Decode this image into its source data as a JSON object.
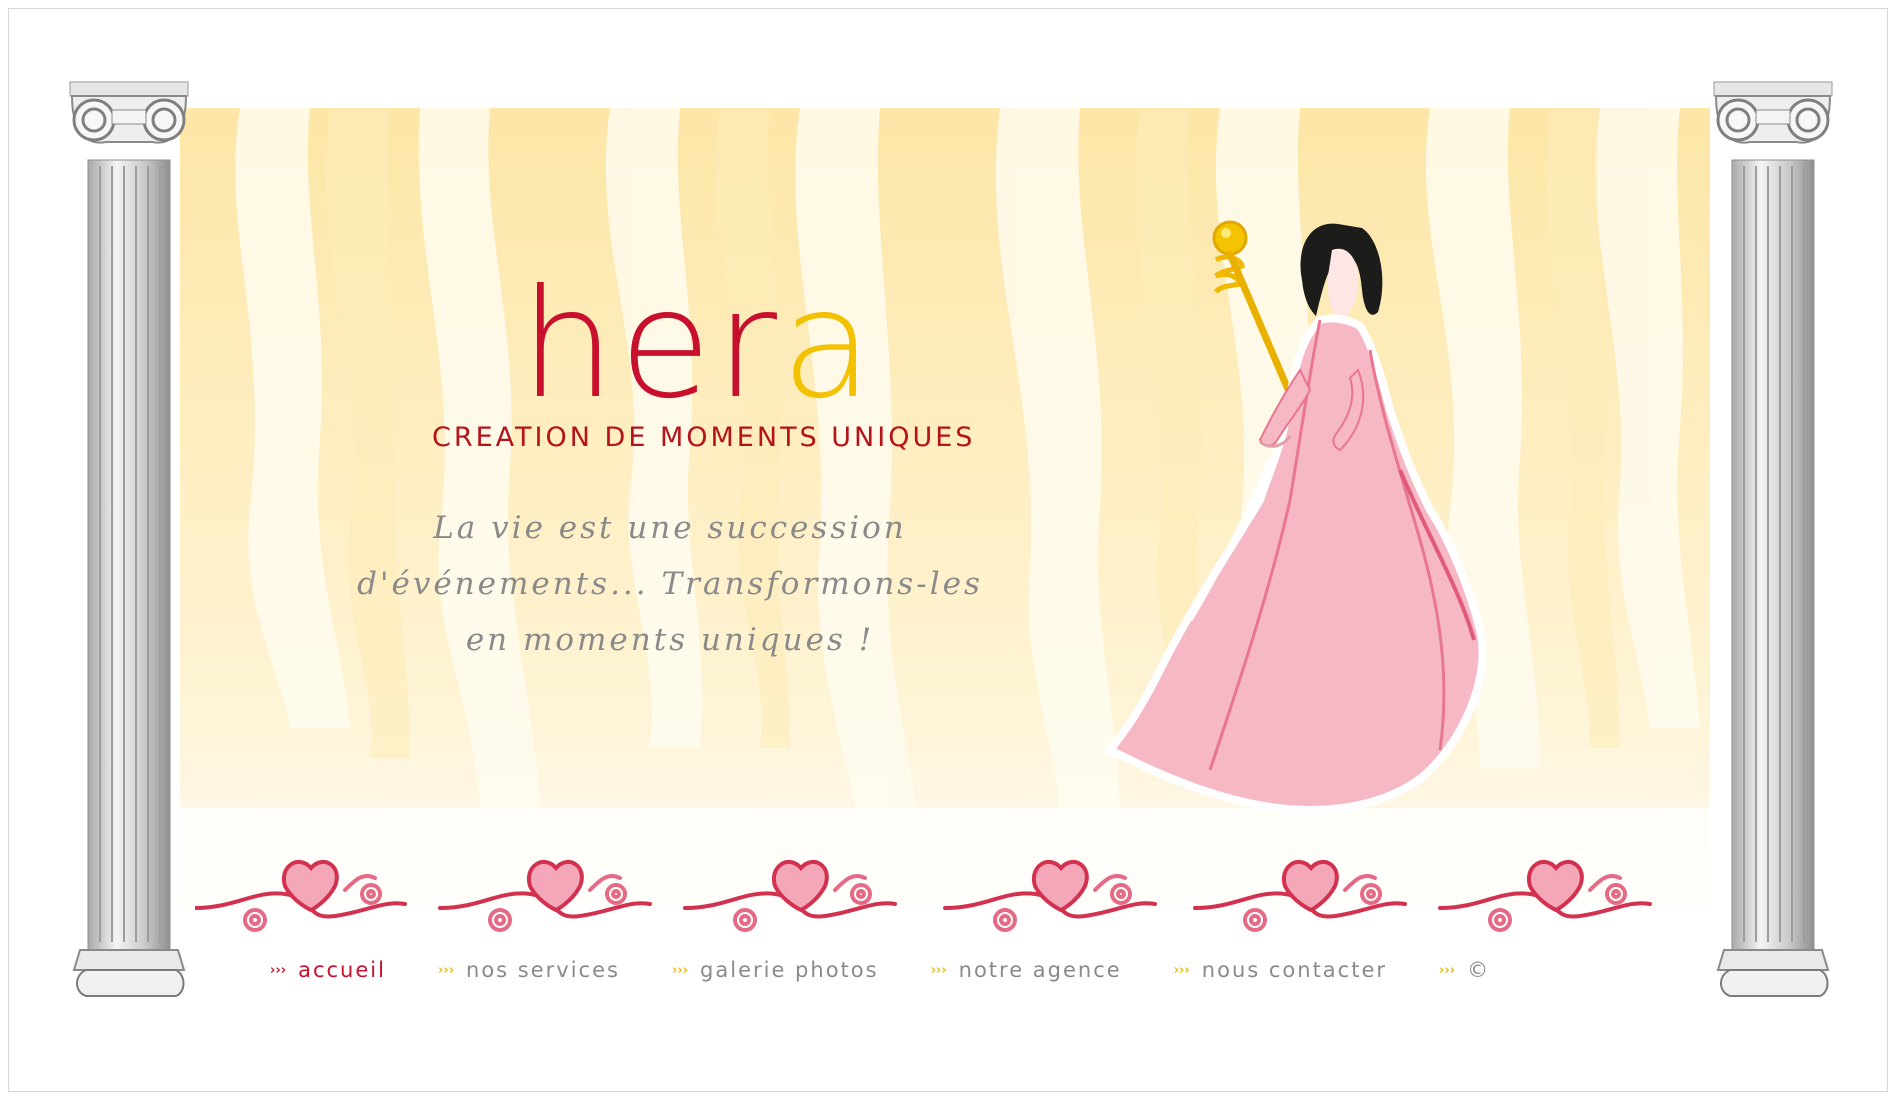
{
  "brand": {
    "logo_h": "h",
    "logo_er": "er",
    "logo_a": "a",
    "tagline": "creation de moments uniques"
  },
  "slogan": {
    "line1": "La vie est une succession",
    "line2": "d'événements... Transformons-les",
    "line3": "en moments uniques !"
  },
  "nav": {
    "arrows": "›››",
    "items": [
      {
        "label": "accueil",
        "active": true
      },
      {
        "label": "nos services",
        "active": false
      },
      {
        "label": "galerie photos",
        "active": false
      },
      {
        "label": "notre agence",
        "active": false
      },
      {
        "label": "nous contacter",
        "active": false
      },
      {
        "label": "©",
        "active": false
      }
    ]
  },
  "colors": {
    "brand_red": "#c8102e",
    "brand_gold": "#f2c200",
    "nav_gray": "#8a8a8a",
    "dress_pink": "#f7b8c6",
    "background_cream": "#fde9b3"
  },
  "icons": {
    "left_column": "ionic-column-icon",
    "right_column": "ionic-column-icon",
    "figure": "goddess-illustration",
    "ornament": "heart-scroll-ornament"
  }
}
